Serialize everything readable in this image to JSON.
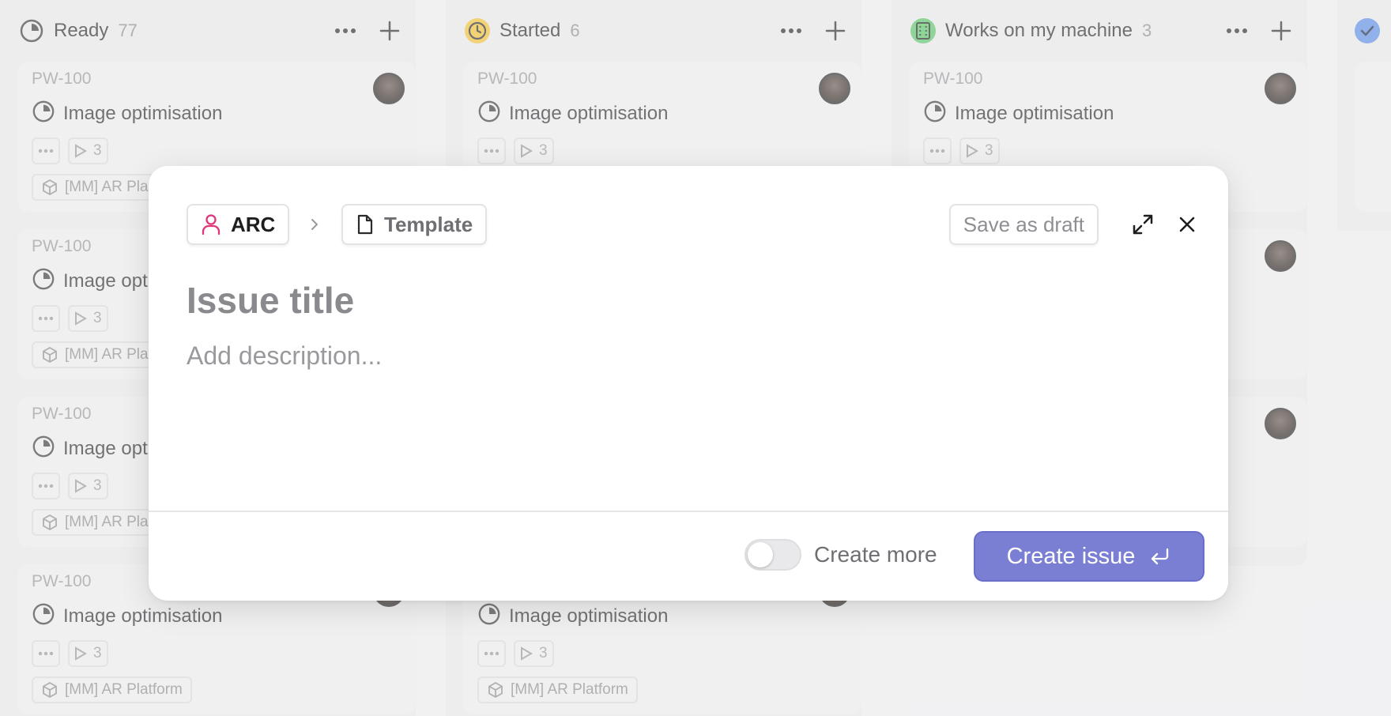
{
  "columns": [
    {
      "title": "Ready",
      "count": "77",
      "status": "ready",
      "status_color": "#3c3c40"
    },
    {
      "title": "Started",
      "count": "6",
      "status": "started",
      "status_color": "#f1c232"
    },
    {
      "title": "Works on my machine",
      "count": "3",
      "status": "works",
      "status_color": "#5bc76b"
    },
    {
      "title": "",
      "count": "",
      "status": "done",
      "status_color": "#5c8fe6"
    }
  ],
  "card": {
    "id": "PW-100",
    "title": "Image optimisation",
    "subissue_count": "3",
    "project": "[MM] AR Platform"
  },
  "modal": {
    "team": "ARC",
    "template": "Template",
    "save_draft": "Save as draft",
    "title_placeholder": "Issue title",
    "description_placeholder": "Add description...",
    "create_more": "Create more",
    "create_more_on": false,
    "create_button": "Create issue",
    "accent": "#7b7fd4",
    "team_color": "#e0357b"
  }
}
